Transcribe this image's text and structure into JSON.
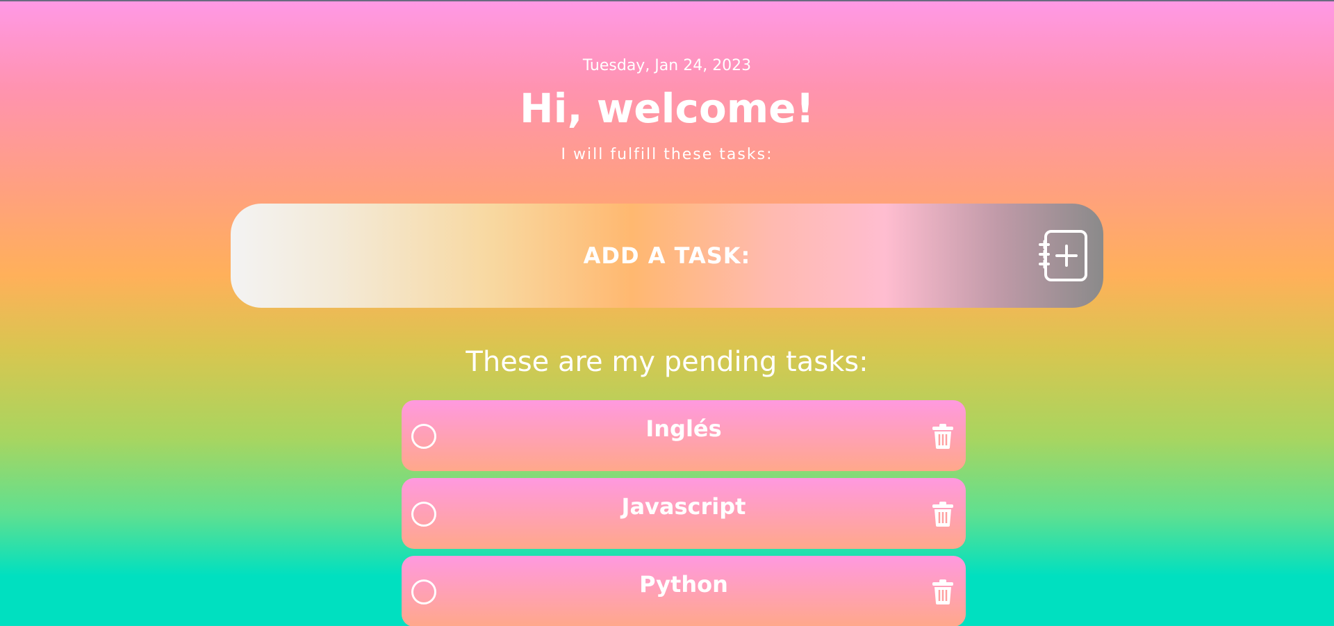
{
  "header": {
    "date": "Tuesday, Jan 24, 2023",
    "title": "Hi, welcome!",
    "subtitle": "I will fulfill these tasks:"
  },
  "add_task": {
    "label": "ADD A TASK:",
    "icon": "add-task-icon"
  },
  "pending": {
    "heading": "These are my pending tasks:",
    "tasks": [
      {
        "label": "Inglés",
        "done": false
      },
      {
        "label": "Javascript",
        "done": false
      },
      {
        "label": "Python",
        "done": false
      }
    ]
  },
  "colors": {
    "text": "#ffffff",
    "task_gradient_top": "#ff99e0",
    "task_gradient_bottom": "#ffa88a"
  }
}
